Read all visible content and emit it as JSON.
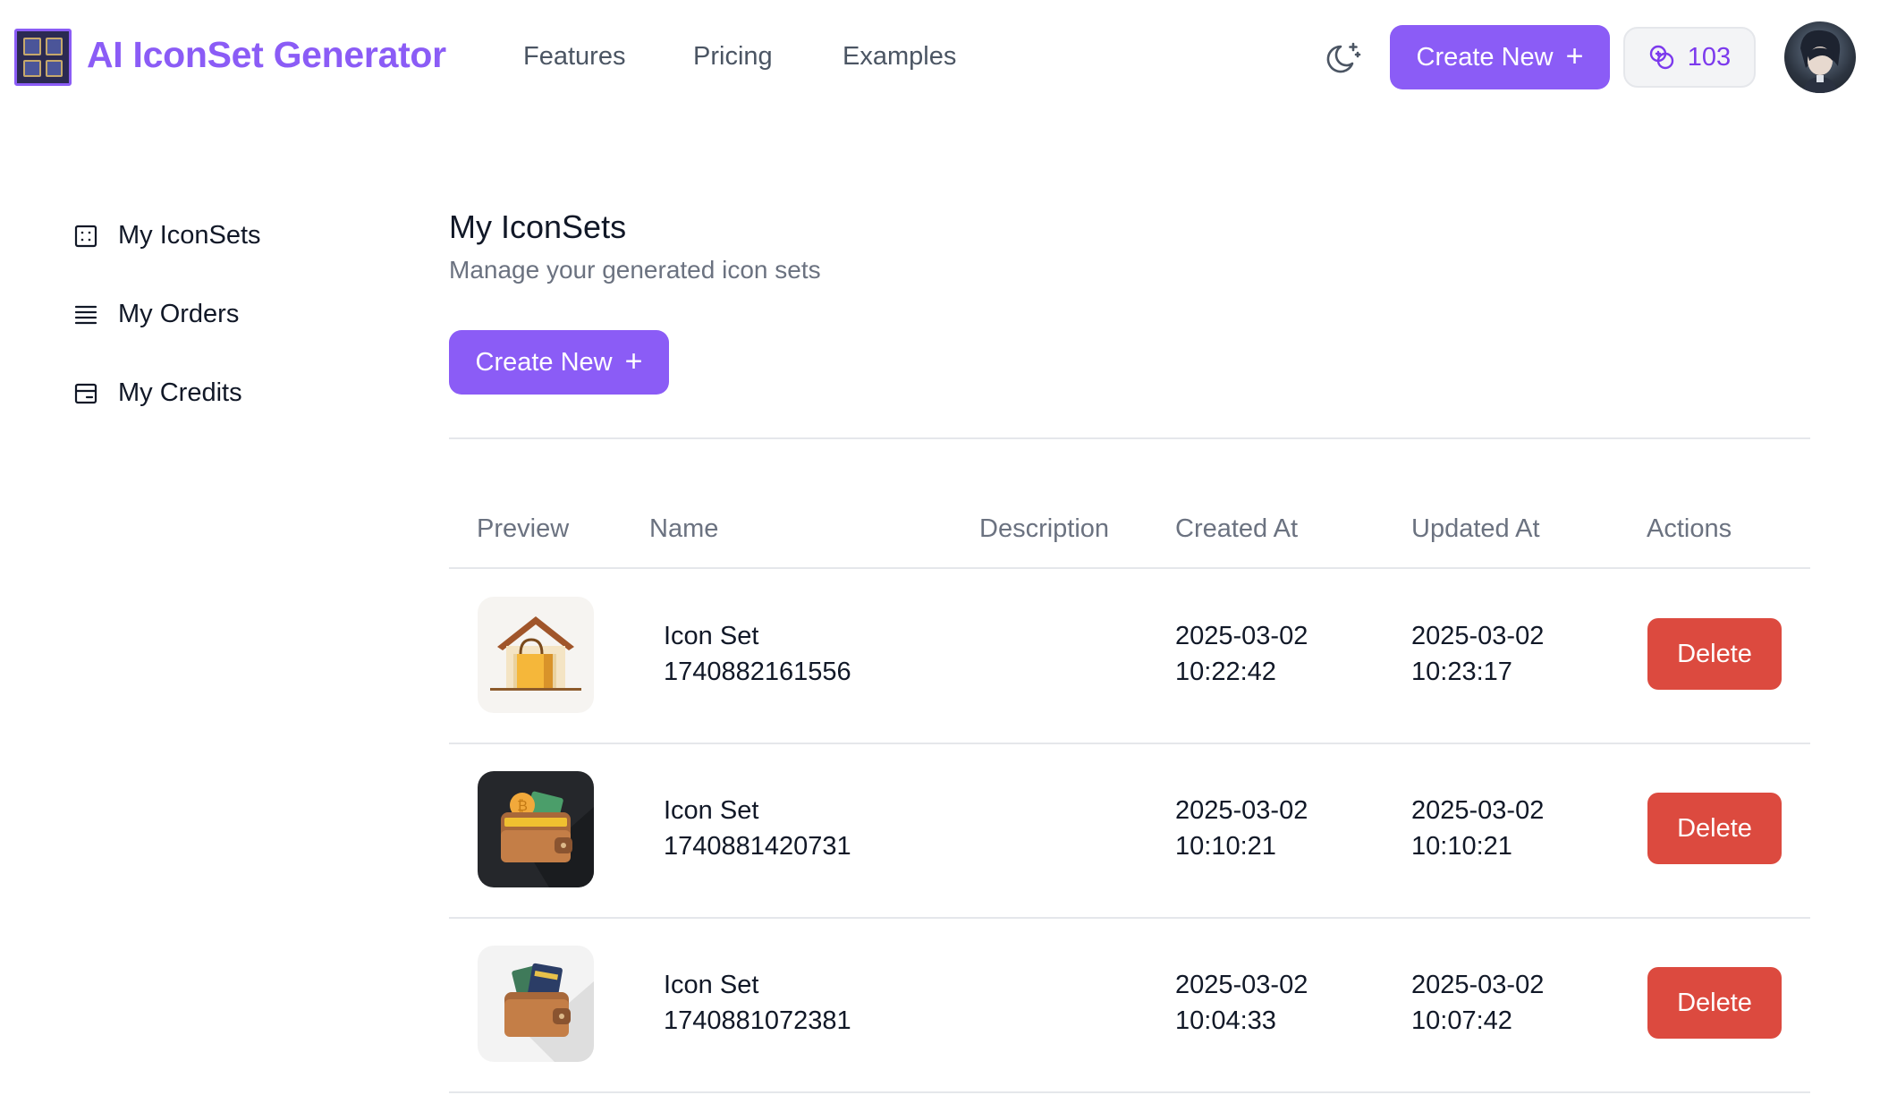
{
  "header": {
    "app_title": "AI IconSet Generator",
    "nav": [
      {
        "label": "Features"
      },
      {
        "label": "Pricing"
      },
      {
        "label": "Examples"
      }
    ],
    "create_label": "Create New",
    "credits": "103",
    "theme_icon": "moon-sparkle-icon",
    "credits_icon": "coins-icon"
  },
  "sidebar": {
    "items": [
      {
        "label": "My IconSets",
        "icon": "grid-icon"
      },
      {
        "label": "My Orders",
        "icon": "list-icon"
      },
      {
        "label": "My Credits",
        "icon": "wallet-icon"
      }
    ]
  },
  "main": {
    "title": "My IconSets",
    "subtitle": "Manage your generated icon sets",
    "create_label": "Create New",
    "table": {
      "columns": [
        "Preview",
        "Name",
        "Description",
        "Created At",
        "Updated At",
        "Actions"
      ],
      "rows": [
        {
          "name_line1": "Icon Set",
          "name_line2": "1740882161556",
          "description": "",
          "created_date": "2025-03-02",
          "created_time": "10:22:42",
          "updated_date": "2025-03-02",
          "updated_time": "10:23:17",
          "action": "Delete",
          "preview": "store-shopping-bag-icon"
        },
        {
          "name_line1": "Icon Set",
          "name_line2": "1740881420731",
          "description": "",
          "created_date": "2025-03-02",
          "created_time": "10:10:21",
          "updated_date": "2025-03-02",
          "updated_time": "10:10:21",
          "action": "Delete",
          "preview": "crypto-wallet-icon"
        },
        {
          "name_line1": "Icon Set",
          "name_line2": "1740881072381",
          "description": "",
          "created_date": "2025-03-02",
          "created_time": "10:04:33",
          "updated_date": "2025-03-02",
          "updated_time": "10:07:42",
          "action": "Delete",
          "preview": "wallet-cards-icon"
        }
      ]
    }
  },
  "colors": {
    "accent": "#8b5cf6",
    "danger": "#dc4a3f",
    "muted_text": "#6b7280",
    "divider": "#e5e7eb"
  }
}
